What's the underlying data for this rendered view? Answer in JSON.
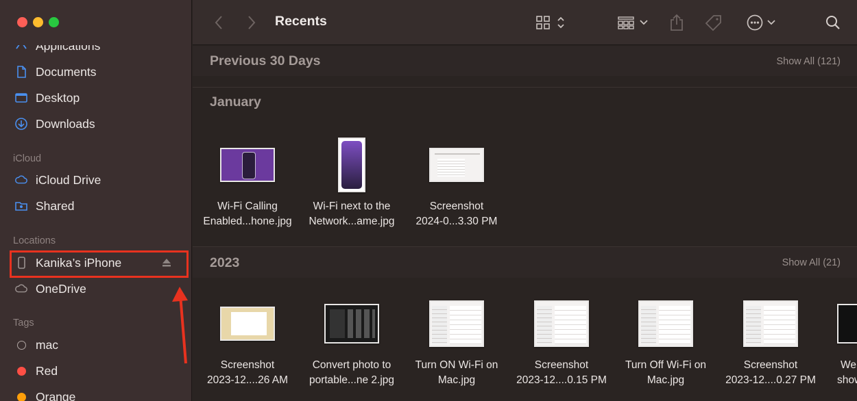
{
  "window": {
    "title": "Recents"
  },
  "sidebar": {
    "favorites": [
      {
        "label": "Applications",
        "icon": "applications-icon"
      },
      {
        "label": "Documents",
        "icon": "document-icon"
      },
      {
        "label": "Desktop",
        "icon": "desktop-icon"
      },
      {
        "label": "Downloads",
        "icon": "downloads-icon"
      }
    ],
    "icloud_header": "iCloud",
    "icloud": [
      {
        "label": "iCloud Drive",
        "icon": "cloud-icon"
      },
      {
        "label": "Shared",
        "icon": "shared-folder-icon"
      }
    ],
    "locations_header": "Locations",
    "locations": [
      {
        "label": "Kanika’s iPhone",
        "icon": "iphone-icon"
      },
      {
        "label": "OneDrive",
        "icon": "cloud-icon"
      }
    ],
    "tags_header": "Tags",
    "tags": [
      {
        "label": "mac",
        "color": "#1f1a19"
      },
      {
        "label": "Red",
        "color": "#fe4f45"
      },
      {
        "label": "Orange",
        "color": "#fe9f0a"
      }
    ]
  },
  "sections": {
    "prev30": {
      "title": "Previous 30 Days",
      "show_all": "Show All (121)"
    },
    "january": {
      "title": "January",
      "files": [
        {
          "line1": "Wi-Fi Calling",
          "line2": "Enabled...hone.jpg"
        },
        {
          "line1": "Wi-Fi next to the",
          "line2": "Network...ame.jpg"
        },
        {
          "line1": "Screenshot",
          "line2": "2024-0...3.30 PM"
        }
      ]
    },
    "y2023": {
      "title": "2023",
      "show_all": "Show All (21)",
      "files": [
        {
          "line1": "Screenshot",
          "line2": "2023-12....26 AM"
        },
        {
          "line1": "Convert photo to",
          "line2": "portable...ne 2.jpg"
        },
        {
          "line1": "Turn ON Wi-Fi on",
          "line2": "Mac.jpg"
        },
        {
          "line1": "Screenshot",
          "line2": "2023-12....0.15 PM"
        },
        {
          "line1": "Turn Off Wi-Fi on",
          "line2": "Mac.jpg"
        },
        {
          "line1": "Screenshot",
          "line2": "2023-12....0.27 PM"
        },
        {
          "line1": "We",
          "line2": "show"
        }
      ]
    }
  },
  "colors": {
    "highlight": "#e8321f",
    "accent": "#3f8ef7"
  }
}
